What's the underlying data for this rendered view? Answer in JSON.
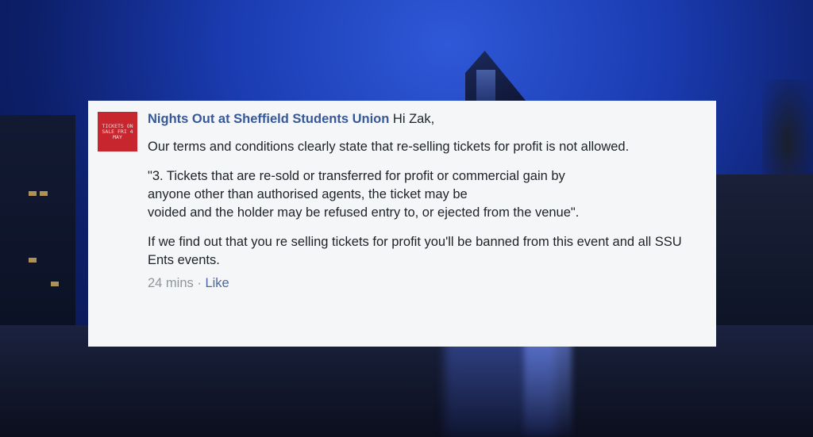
{
  "comment": {
    "author": "Nights Out at Sheffield Students Union",
    "greeting": "Hi Zak,",
    "avatar_text": "TICKETS ON SALE FRI 4 MAY",
    "paragraph1": "Our terms and conditions clearly state that re-selling tickets for profit is not allowed.",
    "quote_line1": "\"3. Tickets that are re-sold or transferred for profit or commercial gain by",
    "quote_line2": "anyone other than authorised agents, the ticket may be",
    "quote_line3": "voided and the holder may be refused entry to, or ejected from the venue\".",
    "paragraph3": "If we find out that you re selling tickets for profit you'll be banned from this event and all SSU Ents events.",
    "timestamp": "24 mins",
    "separator": "·",
    "like_label": "Like"
  },
  "colors": {
    "author_link": "#365899",
    "avatar_bg": "#c8262f",
    "card_bg": "#f5f6f7",
    "meta_text": "#90949c"
  }
}
